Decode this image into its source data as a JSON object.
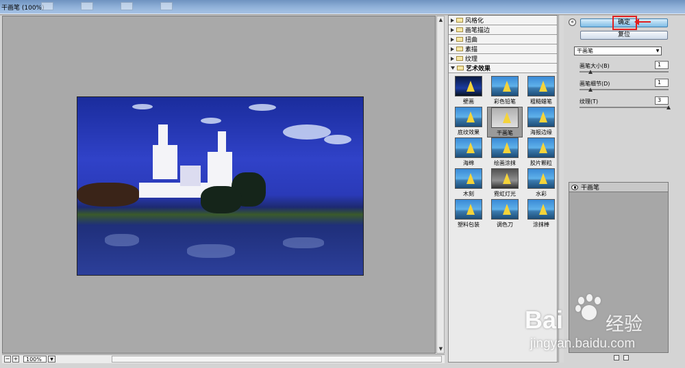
{
  "window": {
    "title": "干画笔 (100%)"
  },
  "status": {
    "zoom": "100%",
    "zoom_out": "−",
    "zoom_in": "+"
  },
  "categories": [
    {
      "label": "风格化",
      "expanded": false
    },
    {
      "label": "画笔描边",
      "expanded": false
    },
    {
      "label": "扭曲",
      "expanded": false
    },
    {
      "label": "素描",
      "expanded": false
    },
    {
      "label": "纹理",
      "expanded": false
    },
    {
      "label": "艺术效果",
      "expanded": true
    }
  ],
  "filters": [
    {
      "label": "壁画",
      "style": "dark"
    },
    {
      "label": "彩色铅笔",
      "style": "normal"
    },
    {
      "label": "粗糙蜡笔",
      "style": "normal"
    },
    {
      "label": "底纹效果",
      "style": "normal"
    },
    {
      "label": "干画笔",
      "style": "selected"
    },
    {
      "label": "海报边缘",
      "style": "normal"
    },
    {
      "label": "海绵",
      "style": "normal"
    },
    {
      "label": "绘画涂抹",
      "style": "normal"
    },
    {
      "label": "胶片颗粒",
      "style": "normal"
    },
    {
      "label": "木刻",
      "style": "normal"
    },
    {
      "label": "霓虹灯光",
      "style": "neon"
    },
    {
      "label": "水彩",
      "style": "normal"
    },
    {
      "label": "塑料包装",
      "style": "normal"
    },
    {
      "label": "调色刀",
      "style": "normal"
    },
    {
      "label": "涂抹棒",
      "style": "normal"
    }
  ],
  "panel": {
    "ok_label": "确定",
    "reset_label": "复位",
    "filter_select": "干画笔",
    "params": [
      {
        "label": "画笔大小(B)",
        "value": "1",
        "level": 0.1
      },
      {
        "label": "画笔细节(D)",
        "value": "1",
        "level": 0.1
      },
      {
        "label": "纹理(T)",
        "value": "3",
        "level": 1.0
      }
    ],
    "layer_name": "干画笔"
  },
  "watermark": {
    "brand": "Bai",
    "cn": "经验",
    "url": "jingyan.baidu.com"
  },
  "colors": {
    "highlight": "#e02020",
    "ok_button": "#7fbde6",
    "preview_bg": "#a9a9a9"
  }
}
